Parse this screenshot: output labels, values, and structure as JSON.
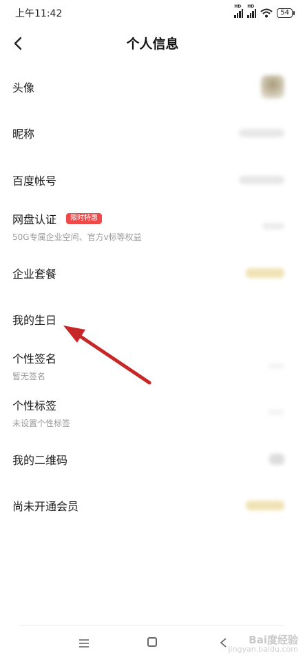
{
  "status_bar": {
    "time": "上午11:42",
    "battery": "54",
    "hd_label": "HD"
  },
  "header": {
    "title": "个人信息"
  },
  "rows": [
    {
      "label": "头像"
    },
    {
      "label": "昵称"
    },
    {
      "label": "百度帐号"
    },
    {
      "label": "网盘认证",
      "badge": "限时特惠",
      "sub": "50G专属企业空间、官方v标等权益"
    },
    {
      "label": "企业套餐"
    },
    {
      "label": "我的生日"
    },
    {
      "label": "个性签名",
      "sub": "暂无签名"
    },
    {
      "label": "个性标签",
      "sub": "未设置个性标签"
    },
    {
      "label": "我的二维码"
    },
    {
      "label": "尚未开通会员"
    }
  ],
  "watermark": {
    "main": "Bai度经验",
    "sub": "jingyan.baidu.com"
  },
  "colors": {
    "accent_badge": "#ef4a4a",
    "arrow": "#c62828"
  },
  "icons": [
    "chevron-left-icon",
    "signal-icon",
    "wifi-icon",
    "battery-icon",
    "menu-icon",
    "home-icon",
    "back-triangle-icon"
  ]
}
